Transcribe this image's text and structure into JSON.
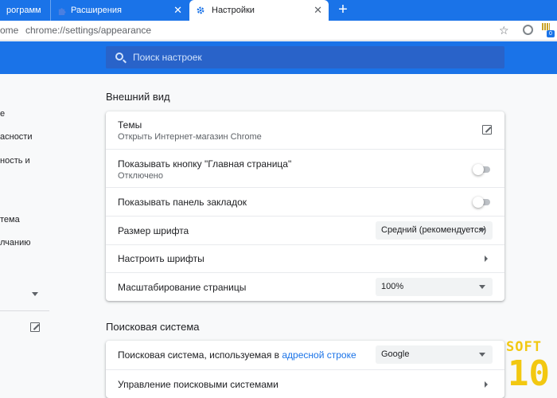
{
  "tabs": [
    {
      "label": "рограмм"
    },
    {
      "label": "Расширения"
    },
    {
      "label": "Настройки"
    }
  ],
  "toolbar": {
    "scheme": "ome",
    "url": "chrome://settings/appearance"
  },
  "search": {
    "placeholder": "Поиск настроек"
  },
  "sidebar": {
    "items": [
      {
        "label": "е"
      },
      {
        "label": "асности"
      },
      {
        "label": "ность и"
      },
      {
        "label": "тема"
      },
      {
        "label": "лчанию"
      }
    ]
  },
  "appearance": {
    "title": "Внешний вид",
    "themes": {
      "label": "Темы",
      "sub": "Открыть Интернет-магазин Chrome"
    },
    "home_button": {
      "label": "Показывать кнопку \"Главная страница\"",
      "sub": "Отключено",
      "enabled": false
    },
    "bookmarks_bar": {
      "label": "Показывать панель закладок",
      "enabled": false
    },
    "font_size": {
      "label": "Размер шрифта",
      "value": "Средний (рекомендуется)"
    },
    "customize_fonts": {
      "label": "Настроить шрифты"
    },
    "page_zoom": {
      "label": "Масштабирование страницы",
      "value": "100%"
    }
  },
  "search_engine": {
    "title": "Поисковая система",
    "engine_label_prefix": "Поисковая система, используемая в ",
    "engine_label_link": "адресной строке",
    "engine_value": "Google",
    "manage": {
      "label": "Управление поисковыми системами"
    }
  },
  "watermark": {
    "top": "SOFT",
    "bottom": "10"
  },
  "colors": {
    "accent": "#1a73e8",
    "watermark": "#f2c811"
  }
}
